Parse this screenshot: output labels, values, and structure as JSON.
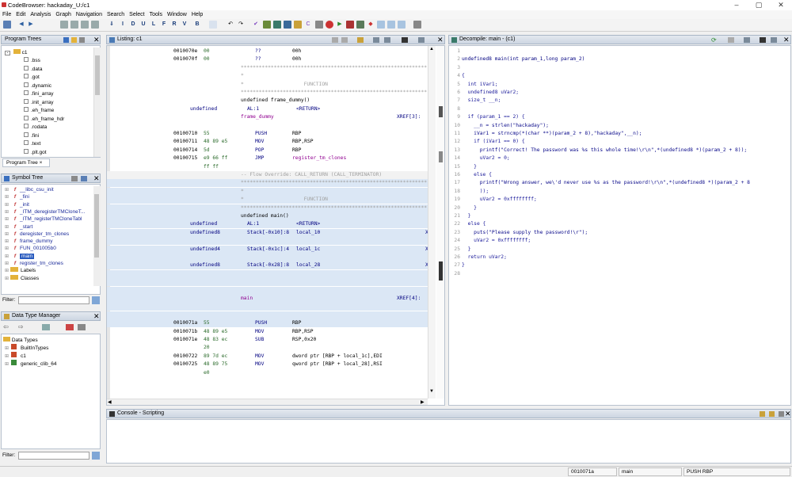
{
  "window": {
    "title": "CodeBrowser: hackaday_U:/c1"
  },
  "menu": [
    "File",
    "Edit",
    "Analysis",
    "Graph",
    "Navigation",
    "Search",
    "Select",
    "Tools",
    "Window",
    "Help"
  ],
  "program_trees": {
    "title": "Program Trees",
    "root": "c1",
    "items": [
      ".bss",
      ".data",
      ".got",
      ".dynamic",
      ".fini_array",
      ".init_array",
      ".eh_frame",
      ".eh_frame_hdr",
      ".rodata",
      ".fini",
      ".text",
      ".plt.got"
    ],
    "tab": "Program Tree"
  },
  "symbol_tree": {
    "title": "Symbol Tree",
    "items": [
      "__libc_csu_init",
      "_fini",
      "_init",
      "_ITM_deregisterTMCloneT...",
      "_ITM_registerTMCloneTabl",
      "_start",
      "deregister_tm_clones",
      "frame_dummy",
      "FUN_001005b0",
      "main",
      "register_tm_clones"
    ],
    "groups": [
      "Labels",
      "Classes"
    ],
    "filter_label": "Filter:"
  },
  "data_type_manager": {
    "title": "Data Type Manager",
    "root": "Data Types",
    "items": [
      "BuiltInTypes",
      "c1",
      "generic_clib_64"
    ],
    "filter_label": "Filter:"
  },
  "listing": {
    "title": "Listing:  c1",
    "rows": [
      {
        "addr": "0010070e",
        "bytes": "00",
        "mnem": "??",
        "ops": "00h"
      },
      {
        "addr": "0010070f",
        "bytes": "00",
        "mnem": "??",
        "ops": "00h"
      },
      {
        "stars": "**************************************************************"
      },
      {
        "stars": "*"
      },
      {
        "stars": "*                    FUNCTION"
      },
      {
        "stars": "**************************************************************"
      },
      {
        "sig": "undefined frame_dummy()"
      },
      {
        "ret": "undefined",
        "reg": "AL:1",
        "retl": "<RETURN>"
      },
      {
        "label": "frame_dummy",
        "xref": "XREF[3]:"
      },
      {
        "blank": ""
      },
      {
        "addr": "00100710",
        "bytes": "55",
        "mnem": "PUSH",
        "ops": "RBP"
      },
      {
        "addr": "00100711",
        "bytes": "48 89 e5",
        "mnem": "MOV",
        "ops": "RBP,RSP"
      },
      {
        "addr": "00100714",
        "bytes": "5d",
        "mnem": "POP",
        "ops": "RBP"
      },
      {
        "addr": "00100715",
        "bytes": "e9 66 ff",
        "mnem": "JMP",
        "ops": "register_tm_clones"
      },
      {
        "cont": "ff ff"
      },
      {
        "flow": "-- Flow Override: CALL_RETURN (CALL_TERMINATOR)"
      }
    ],
    "main_block": {
      "stars1": "**************************************************************",
      "star": "*",
      "func": "*                    FUNCTION",
      "stars2": "**************************************************************",
      "sig": "undefined main()",
      "params": [
        {
          "type": "undefined",
          "loc": "AL:1",
          "name": "<RETURN>"
        },
        {
          "type": "undefined8",
          "loc": "Stack[-0x10]:8",
          "name": "local_10",
          "x": "X"
        },
        {
          "type": "undefined4",
          "loc": "Stack[-0x1c]:4",
          "name": "local_1c",
          "x": "X"
        },
        {
          "type": "undefined8",
          "loc": "Stack[-0x28]:8",
          "name": "local_28",
          "x": "X"
        }
      ],
      "label": "main",
      "xref": "XREF[4]:",
      "addr": "0010071a",
      "bytes": "55",
      "mnem": "PUSH",
      "ops": "RBP"
    },
    "rows2": [
      {
        "addr": "0010071b",
        "bytes": "48 89 e5",
        "mnem": "MOV",
        "ops": "RBP,RSP"
      },
      {
        "addr": "0010071e",
        "bytes": "48 83 ec",
        "mnem": "SUB",
        "ops": "RSP,0x20"
      },
      {
        "cont": "20"
      },
      {
        "addr": "00100722",
        "bytes": "89 7d ec",
        "mnem": "MOV",
        "ops": "dword ptr [RBP + local_1c],EDI"
      },
      {
        "addr": "00100725",
        "bytes": "48 89 75",
        "mnem": "MOV",
        "ops": "qword ptr [RBP + local_28],RSI"
      },
      {
        "cont": "e0"
      }
    ]
  },
  "decompile": {
    "title": "Decompile: main -  (c1)",
    "lines": [
      "",
      "undefined8 main(int param_1,long param_2)",
      "",
      "{",
      "  int iVar1;",
      "  undefined8 uVar2;",
      "  size_t __n;",
      "",
      "  if (param_1 == 2) {",
      "    __n = strlen(\"hackaday\");",
      "    iVar1 = strncmp(*(char **)(param_2 + 8),\"hackaday\",__n);",
      "    if (iVar1 == 0) {",
      "      printf(\"Correct! The password was %s this whole time!\\r\\n\",*(undefined8 *)(param_2 + 8));",
      "      uVar2 = 0;",
      "    }",
      "    else {",
      "      printf(\"Wrong answer, we\\'d never use %s as the password!\\r\\n\",*(undefined8 *)(param_2 + 8",
      "      ));",
      "      uVar2 = 0xffffffff;",
      "    }",
      "  }",
      "  else {",
      "    puts(\"Please supply the password!\\r\");",
      "    uVar2 = 0xffffffff;",
      "  }",
      "  return uVar2;",
      "}",
      ""
    ]
  },
  "console": {
    "title": "Console - Scripting"
  },
  "status": {
    "addr": "0010071a",
    "func": "main",
    "instr": "PUSH RBP"
  }
}
